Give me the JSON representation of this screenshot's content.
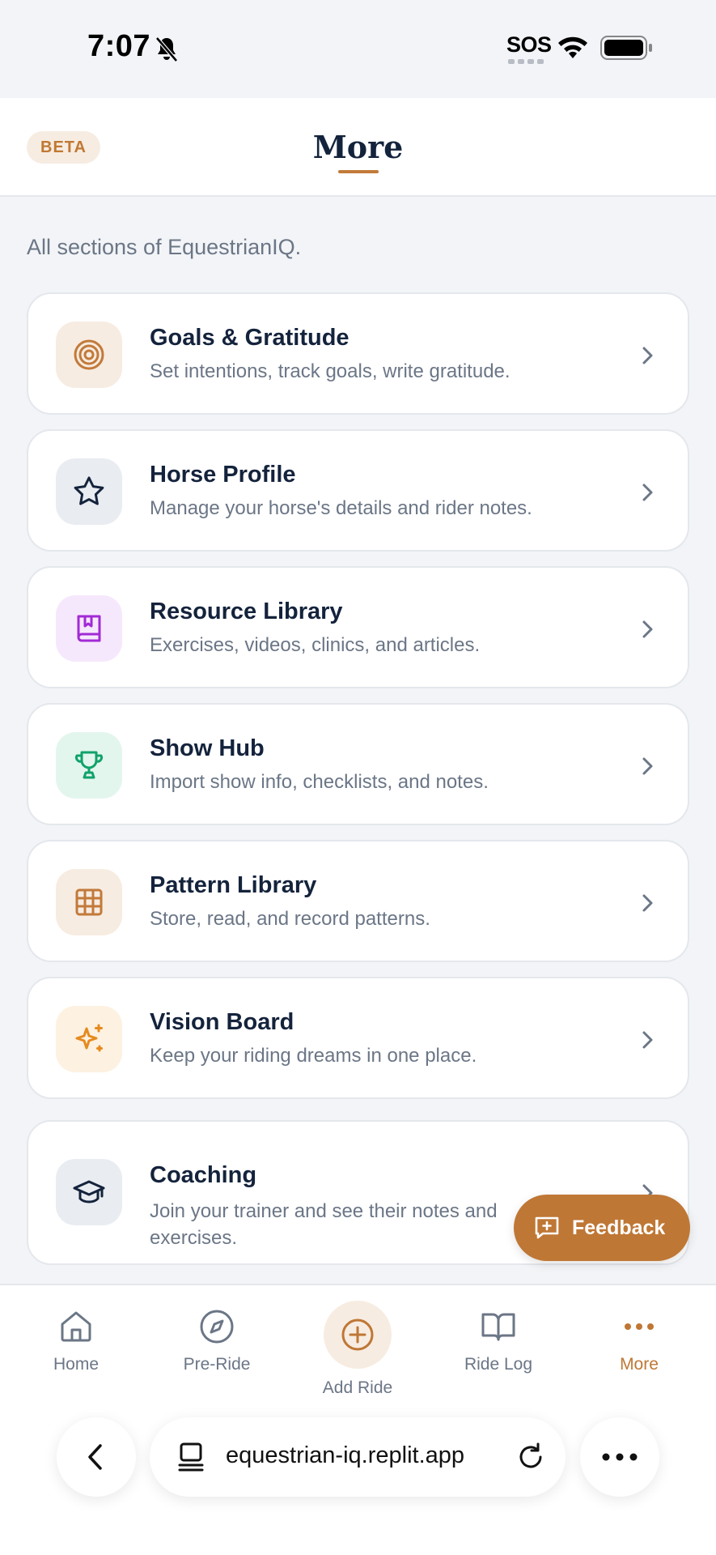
{
  "status_bar": {
    "time": "7:07",
    "carrier": "SOS"
  },
  "header": {
    "badge": "BETA",
    "title": "More"
  },
  "subtitle": "All sections of EquestrianIQ.",
  "sections": [
    {
      "title": "Goals & Gratitude",
      "description": "Set intentions, track goals, write gratitude.",
      "icon": "target-icon",
      "icon_color": "#c27a3a",
      "icon_bg": "#f7ece1"
    },
    {
      "title": "Horse Profile",
      "description": "Manage your horse's details and rider notes.",
      "icon": "star-icon",
      "icon_color": "#14233c",
      "icon_bg": "#e9ecf1"
    },
    {
      "title": "Resource Library",
      "description": "Exercises, videos, clinics, and articles.",
      "icon": "book-icon",
      "icon_color": "#a22ad6",
      "icon_bg": "#f6e8fc"
    },
    {
      "title": "Show Hub",
      "description": "Import show info, checklists, and notes.",
      "icon": "trophy-icon",
      "icon_color": "#10a36b",
      "icon_bg": "#e3f6ee"
    },
    {
      "title": "Pattern Library",
      "description": "Store, read, and record patterns.",
      "icon": "grid-icon",
      "icon_color": "#c27a3a",
      "icon_bg": "#f7ece1"
    },
    {
      "title": "Vision Board",
      "description": "Keep your riding dreams in one place.",
      "icon": "sparkles-icon",
      "icon_color": "#e68a1e",
      "icon_bg": "#fdf1e1"
    },
    {
      "title": "Coaching",
      "description": "Join your trainer and see their notes and exercises.",
      "icon": "graduation-cap-icon",
      "icon_color": "#14233c",
      "icon_bg": "#e9ecf1"
    }
  ],
  "feedback": {
    "label": "Feedback"
  },
  "nav": {
    "items": [
      {
        "label": "Home",
        "icon": "home-icon"
      },
      {
        "label": "Pre-Ride",
        "icon": "compass-icon"
      },
      {
        "label": "Add Ride",
        "icon": "plus-circle-icon"
      },
      {
        "label": "Ride Log",
        "icon": "open-book-icon"
      },
      {
        "label": "More",
        "icon": "more-dots-icon",
        "active": true
      }
    ]
  },
  "browser": {
    "url": "equestrian-iq.replit.app"
  },
  "colors": {
    "accent": "#bf7735",
    "text": "#14233c",
    "muted": "#6b7686",
    "background": "#f2f4f7"
  }
}
